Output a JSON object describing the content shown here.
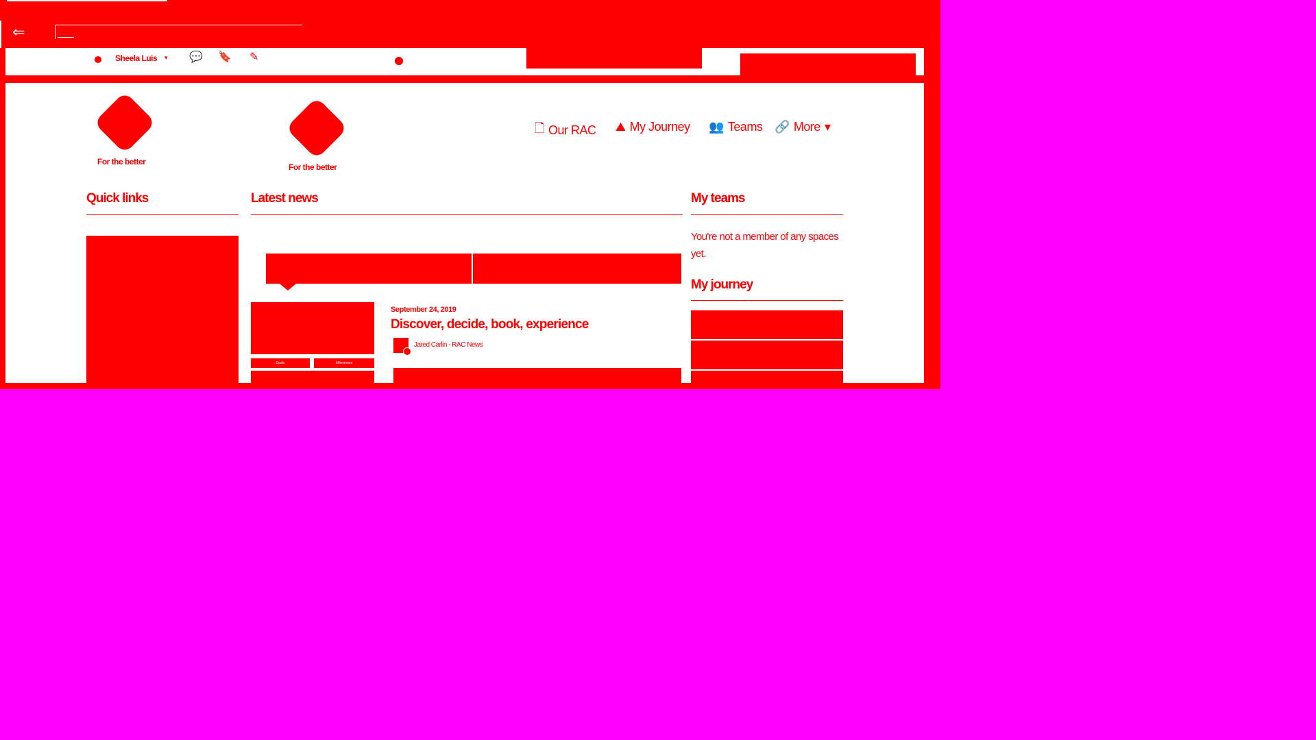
{
  "browser": {
    "back_glyph": "⇐"
  },
  "toolbar": {
    "user_name": "Sheela Luis",
    "user_caret": "▾",
    "chat_glyph": "💬",
    "bookmark_glyph": "🔖",
    "edit_glyph": "✎"
  },
  "brand": {
    "tagline": "For the better",
    "accent_color": "#ff0000",
    "backdrop_color": "#ff00ff"
  },
  "nav": {
    "items": [
      {
        "label": "Our RAC",
        "icon": "document-icon",
        "glyph": "🗋"
      },
      {
        "label": "My Journey",
        "icon": "road-icon",
        "glyph": "⛰"
      },
      {
        "label": "Teams",
        "icon": "people-icon",
        "glyph": "👥"
      },
      {
        "label": "More",
        "icon": "link-icon",
        "glyph": "🔗",
        "caret": "▾"
      }
    ]
  },
  "sections": {
    "quick_links": "Quick links",
    "latest_news": "Latest news",
    "my_teams": "My teams",
    "my_teams_empty": "You're not a member of any spaces yet.",
    "my_journey": "My journey"
  },
  "article": {
    "date": "September 24, 2019",
    "title": "Discover, decide, book, experience",
    "author": "Jared Carlin - RAC News",
    "thumb_labels": [
      "Goals",
      "Milestones"
    ]
  }
}
